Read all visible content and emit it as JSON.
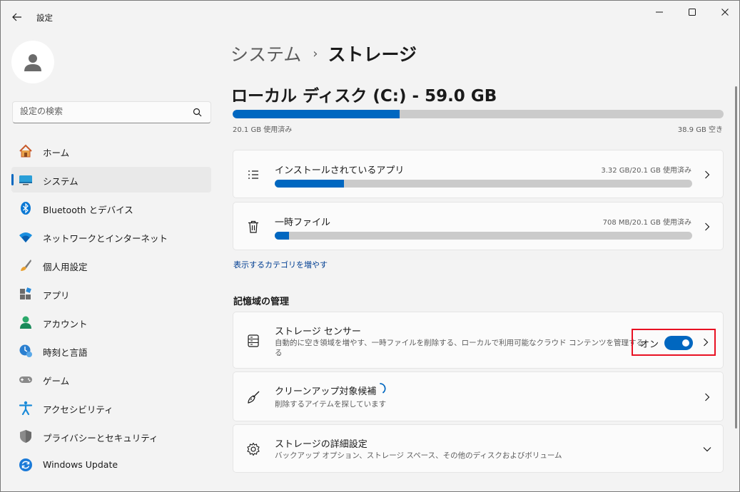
{
  "window": {
    "title": "設定",
    "controls": {
      "minimize": "minimize-icon",
      "maximize": "maximize-icon",
      "close": "close-icon"
    }
  },
  "search": {
    "placeholder": "設定の検索"
  },
  "sidebar": {
    "items": [
      {
        "label": "ホーム",
        "icon": "home-icon"
      },
      {
        "label": "システム",
        "icon": "system-display-icon",
        "active": true
      },
      {
        "label": "Bluetooth とデバイス",
        "icon": "bluetooth-icon"
      },
      {
        "label": "ネットワークとインターネット",
        "icon": "wifi-icon"
      },
      {
        "label": "個人用設定",
        "icon": "brush-icon"
      },
      {
        "label": "アプリ",
        "icon": "apps-icon"
      },
      {
        "label": "アカウント",
        "icon": "account-icon"
      },
      {
        "label": "時刻と言語",
        "icon": "time-language-icon"
      },
      {
        "label": "ゲーム",
        "icon": "gamepad-icon"
      },
      {
        "label": "アクセシビリティ",
        "icon": "accessibility-icon"
      },
      {
        "label": "プライバシーとセキュリティ",
        "icon": "shield-icon"
      },
      {
        "label": "Windows Update",
        "icon": "windows-update-icon"
      }
    ]
  },
  "breadcrumb": {
    "parent": "システム",
    "separator": "›",
    "current": "ストレージ"
  },
  "disk": {
    "title": "ローカル ディスク (C:) - 59.0 GB",
    "used_label": "20.1 GB 使用済み",
    "free_label": "38.9 GB 空き",
    "used_fraction": 0.34
  },
  "categories": [
    {
      "title": "インストールされているアプリ",
      "usage": "3.32 GB/20.1 GB 使用済み",
      "fraction": 0.165,
      "icon": "list-icon"
    },
    {
      "title": "一時ファイル",
      "usage": "708 MB/20.1 GB 使用済み",
      "fraction": 0.034,
      "icon": "trash-icon"
    }
  ],
  "more_categories_link": "表示するカテゴリを増やす",
  "storage_management": {
    "heading": "記憶域の管理",
    "sense": {
      "title": "ストレージ センサー",
      "description": "自動的に空き領域を増やす、一時ファイルを削除する、ローカルで利用可能なクラウド コンテンツを管理する",
      "description_line2": "る",
      "toggle_label": "オン",
      "toggle_on": true,
      "icon": "storage-drive-icon"
    },
    "cleanup": {
      "title": "クリーンアップ対象候補",
      "description": "削除するアイテムを探しています",
      "icon": "broom-icon"
    },
    "advanced": {
      "title": "ストレージの詳細設定",
      "description": "バックアップ オプション、ストレージ スペース、その他のディスクおよびボリューム",
      "icon": "gear-icon"
    }
  },
  "colors": {
    "accent": "#0067c0",
    "highlight_box": "#e81123",
    "bar_track": "#cbcbcb"
  }
}
